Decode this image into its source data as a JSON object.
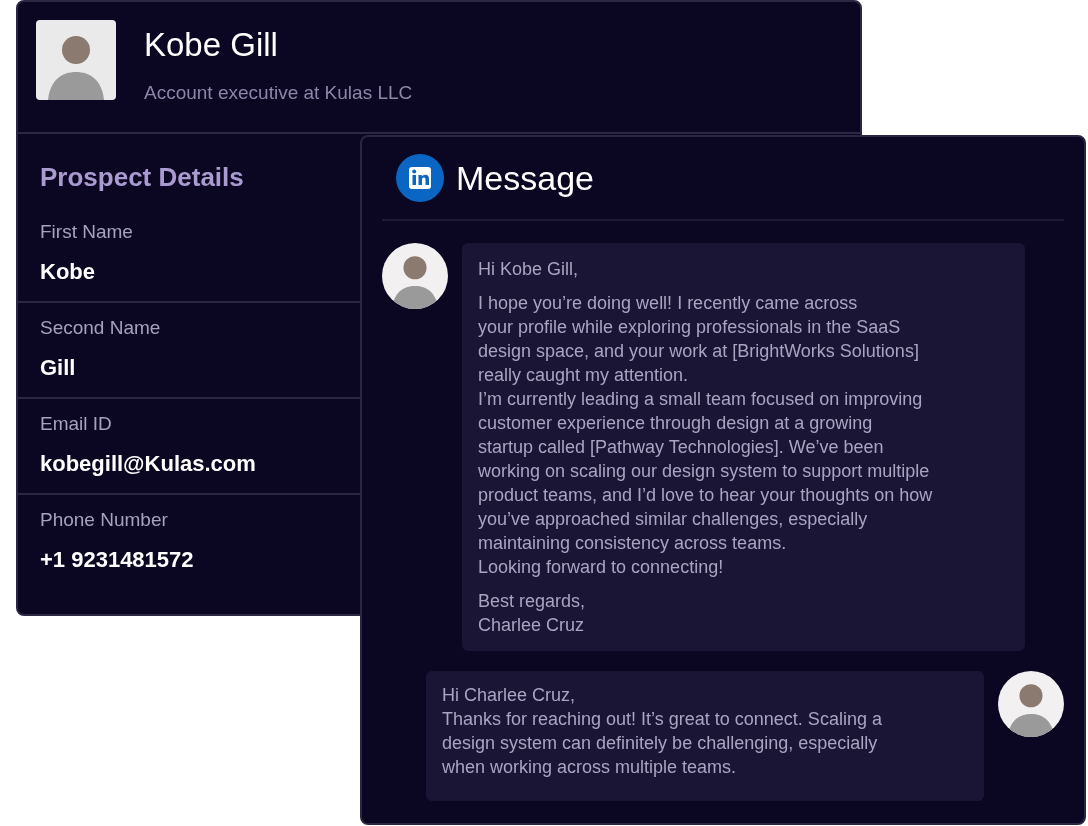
{
  "profile": {
    "name": "Kobe Gill",
    "headline": "Account executive at Kulas LLC"
  },
  "prospect_details": {
    "title": "Prospect Details",
    "fields": [
      {
        "label": "First Name",
        "value": "Kobe"
      },
      {
        "label": "Second Name",
        "value": "Gill"
      },
      {
        "label": "Email ID",
        "value": "kobegill@Kulas.com"
      },
      {
        "label": "Phone Number",
        "value": "+1 9231481572"
      }
    ]
  },
  "message_panel": {
    "title": "Message",
    "messages": [
      {
        "kind": "incoming",
        "paragraphs": [
          "Hi Kobe Gill,",
          "I hope you’re doing well! I recently came across\nyour profile while exploring professionals in the SaaS\ndesign space, and your work at [BrightWorks Solutions]\nreally caught my attention.\nI’m currently leading a small team focused on improving\ncustomer experience through design at a growing\nstartup called [Pathway Technologies]. We’ve been\nworking on scaling our design system to support multiple\nproduct teams, and I’d love to hear your thoughts on how\nyou’ve approached similar challenges, especially\nmaintaining consistency across teams.\nLooking forward to connecting!",
          "Best regards,\nCharlee Cruz"
        ]
      },
      {
        "kind": "outgoing",
        "paragraphs": [
          "Hi Charlee Cruz,\nThanks for reaching out! It’s great to connect. Scaling a\ndesign system can definitely be challenging, especially\nwhen working across multiple teams."
        ]
      }
    ]
  }
}
